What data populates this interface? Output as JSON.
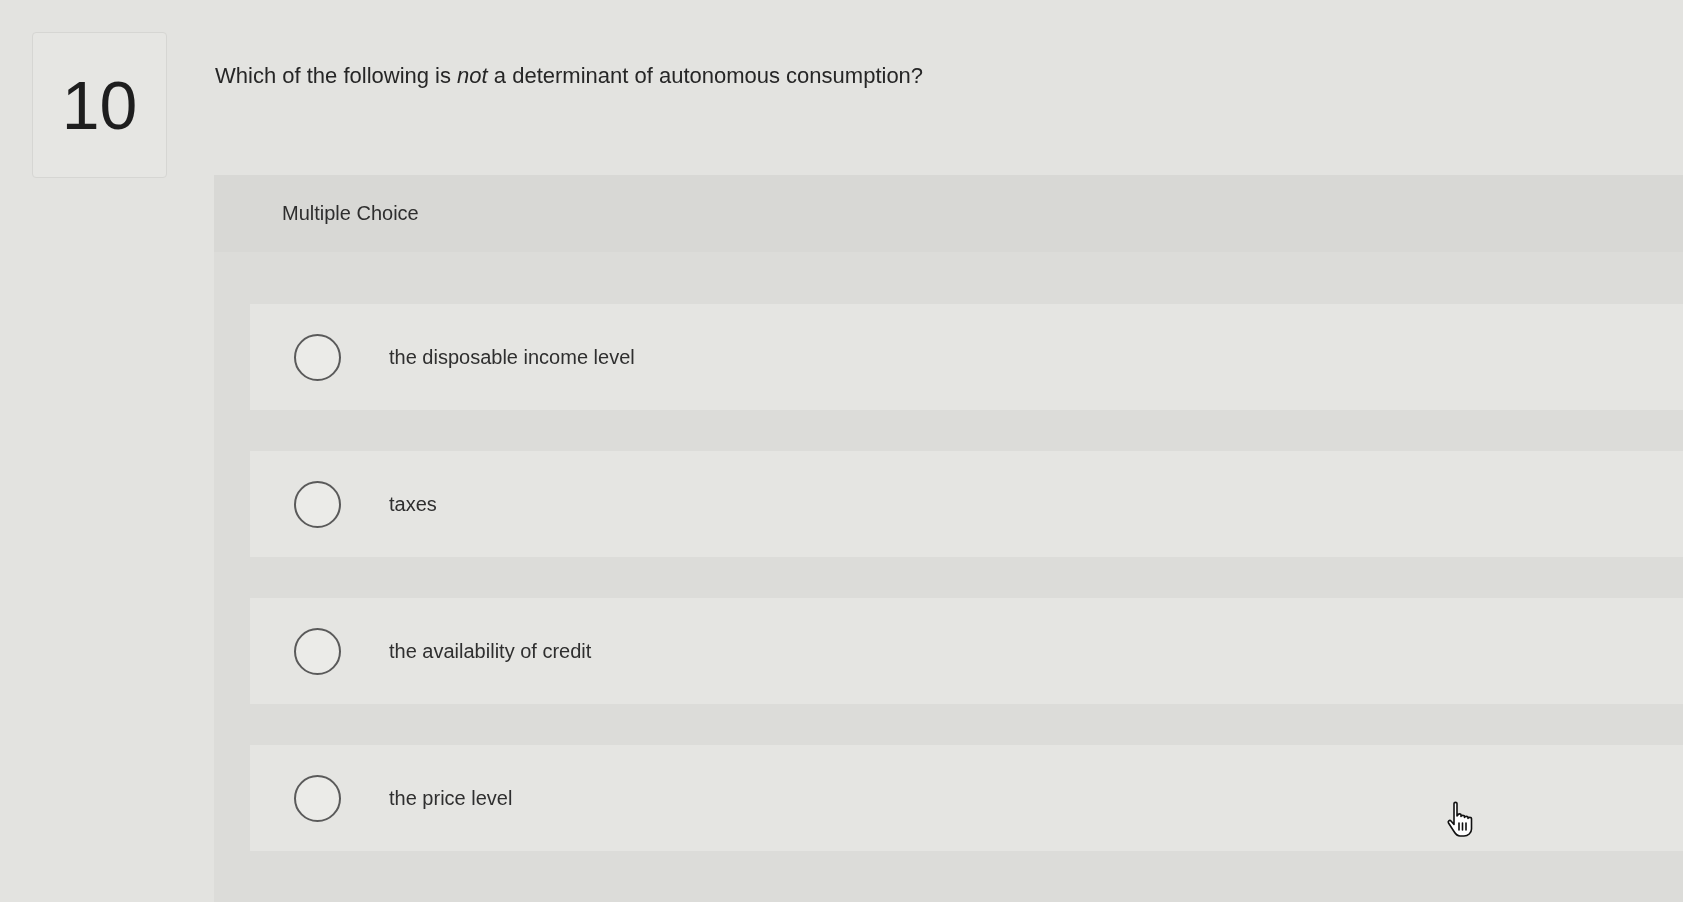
{
  "question": {
    "number": "10",
    "text": "Which of the following is *not* a determinant of autonomous consumption?"
  },
  "answer_panel": {
    "heading": "Multiple Choice",
    "options": [
      {
        "label": "the disposable income level",
        "selected": false
      },
      {
        "label": "taxes",
        "selected": false
      },
      {
        "label": "the availability of credit",
        "selected": false
      },
      {
        "label": "the price level",
        "selected": false
      }
    ]
  }
}
